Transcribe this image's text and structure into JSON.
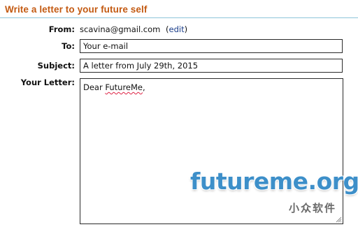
{
  "header": {
    "title": "Write a letter to your future self"
  },
  "form": {
    "from": {
      "label": "From:",
      "email": "scavina@gmail.com",
      "edit_open": "(",
      "edit_link": "edit",
      "edit_close": ")"
    },
    "to": {
      "label": "To:",
      "value": "Your e-mail"
    },
    "subject": {
      "label": "Subject:",
      "value": "A letter from July 29th, 2015"
    },
    "letter": {
      "label": "Your Letter:",
      "greeting": "Dear",
      "name": "FutureMe",
      "comma": ","
    }
  },
  "watermark": {
    "text": "futureme.org",
    "sub": "小众软件"
  },
  "colors": {
    "title": "#c35a12",
    "rule": "#8dc5d9",
    "link": "#1a3d8a",
    "watermark": "#3d8fc9"
  }
}
